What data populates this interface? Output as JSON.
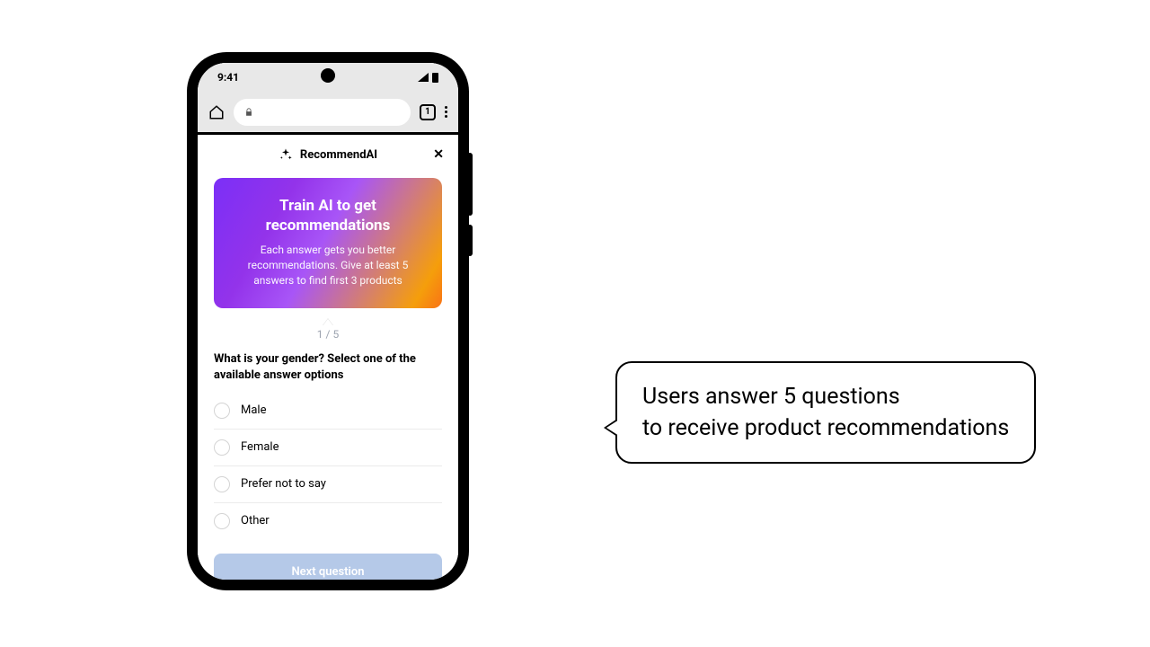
{
  "status": {
    "time": "9:41",
    "tab_count": "1"
  },
  "app": {
    "name": "RecommendAI"
  },
  "hero": {
    "title": "Train AI to get recommendations",
    "desc": "Each answer gets you better recommendations. Give at least 5 answers to find first 3 products"
  },
  "progress": {
    "counter": "1 / 5"
  },
  "question": {
    "text": "What is your gender? Select one of the available answer options",
    "options": [
      {
        "label": "Male"
      },
      {
        "label": "Female"
      },
      {
        "label": "Prefer not to say"
      },
      {
        "label": "Other"
      }
    ]
  },
  "buttons": {
    "next": "Next question"
  },
  "callout": {
    "text": "Users answer 5 questions\nto receive product recommendations"
  }
}
